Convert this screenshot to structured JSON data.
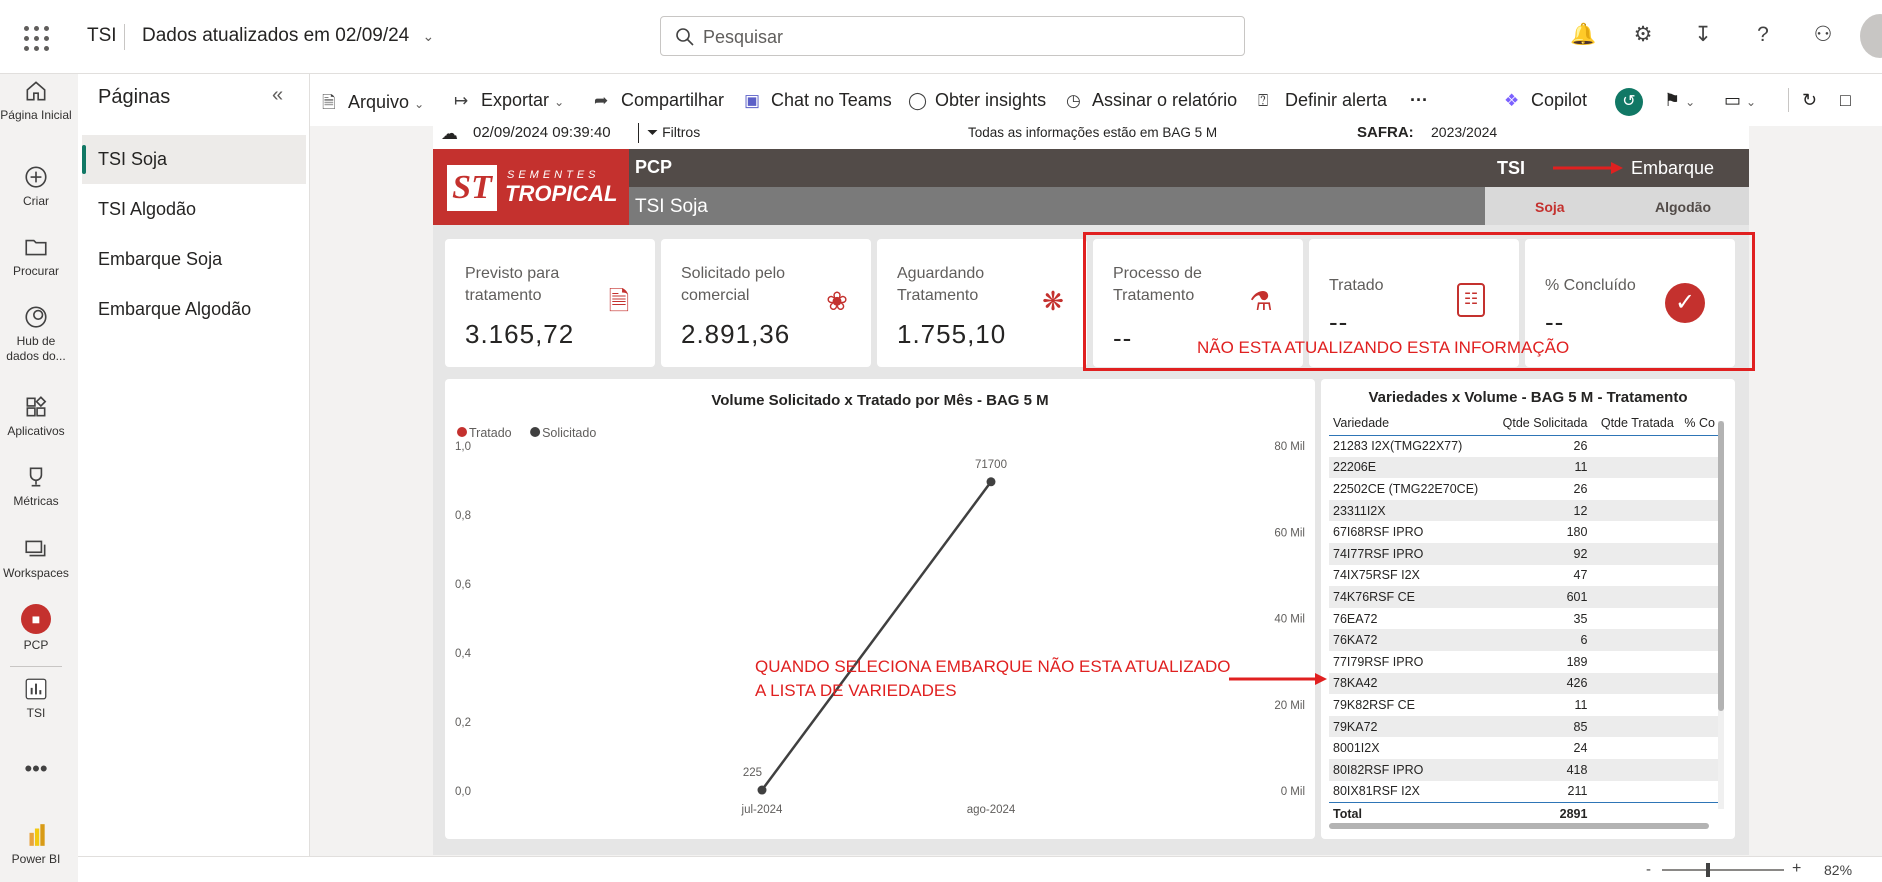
{
  "topbar": {
    "app_name": "TSI",
    "data_updated": "Dados atualizados em 02/09/24",
    "search_placeholder": "Pesquisar"
  },
  "leftnav": [
    {
      "label": "Página Inicial",
      "icon": "home-icon"
    },
    {
      "label": "Criar",
      "icon": "plus-circle-icon"
    },
    {
      "label": "Procurar",
      "icon": "folder-icon"
    },
    {
      "label": "Hub de dados do...",
      "icon": "data-hub-icon"
    },
    {
      "label": "Aplicativos",
      "icon": "apps-icon"
    },
    {
      "label": "Métricas",
      "icon": "trophy-icon"
    },
    {
      "label": "Workspaces",
      "icon": "workspaces-icon"
    },
    {
      "label": "PCP",
      "icon": "pcp-workspace-icon"
    },
    {
      "label": "TSI",
      "icon": "report-icon"
    },
    {
      "label": "Power BI",
      "icon": "powerbi-logo-icon"
    }
  ],
  "pages": {
    "title": "Páginas",
    "items": [
      "TSI Soja",
      "TSI Algodão",
      "Embarque Soja",
      "Embarque Algodão"
    ]
  },
  "commands": [
    "Arquivo",
    "Exportar",
    "Compartilhar",
    "Chat no Teams",
    "Obter insights",
    "Assinar o relatório",
    "Definir alerta",
    "Copilot"
  ],
  "report": {
    "timestamp": "02/09/2024 09:39:40",
    "filters_label": "Filtros",
    "info_note": "Todas as informações estão em BAG 5 M",
    "safra_label": "SAFRA:",
    "safra_value": "2023/2024",
    "section": "PCP",
    "page_subtitle": "TSI Soja",
    "tsi_label": "TSI",
    "embarque_label": "Embarque",
    "tab_soja": "Soja",
    "tab_algodao": "Algodão",
    "logo_text_top": "SEMENTES",
    "logo_text_bottom": "TROPICAL",
    "logo_mark": "ST"
  },
  "kpis": [
    {
      "label": "Previsto para tratamento",
      "value": "3.165,72",
      "icon": "document-icon"
    },
    {
      "label": "Solicitado pelo comercial",
      "value": "2.891,36",
      "icon": "badge-check-icon"
    },
    {
      "label": "Aguardando Tratamento",
      "value": "1.755,10",
      "icon": "seeds-icon"
    },
    {
      "label": "Processo de Tratamento",
      "value": "--",
      "icon": "flask-icon"
    },
    {
      "label": "Tratado",
      "value": "--",
      "icon": "bag-icon"
    },
    {
      "label": "% Concluído",
      "value": "--",
      "icon": "checkmark-circle-icon"
    }
  ],
  "annotations": {
    "kpi_note": "NÃO ESTA ATUALIZANDO ESTA INFORMAÇÃO",
    "table_note_line1": "QUANDO SELECIONA EMBARQUE NÃO ESTA ATUALIZADO",
    "table_note_line2": "A LISTA DE VARIEDADES"
  },
  "chart_data": {
    "type": "line",
    "title": "Volume Solicitado x Tratado por Mês - BAG 5 M",
    "categories": [
      "jul-2024",
      "ago-2024"
    ],
    "series": [
      {
        "name": "Tratado",
        "values": [
          null,
          null
        ],
        "color": "#c4312e",
        "axis": "left"
      },
      {
        "name": "Solicitado",
        "values": [
          225,
          71700
        ],
        "color": "#404040",
        "axis": "right"
      }
    ],
    "data_labels": [
      "225",
      "71700"
    ],
    "y_left": {
      "ticks": [
        "0,0",
        "0,2",
        "0,4",
        "0,6",
        "0,8",
        "1,0"
      ],
      "range": [
        0,
        1
      ]
    },
    "y_right": {
      "ticks": [
        "0 Mil",
        "20 Mil",
        "40 Mil",
        "60 Mil",
        "80 Mil"
      ],
      "range": [
        0,
        80000
      ]
    },
    "legend": "top-left"
  },
  "table": {
    "title": "Variedades x Volume - BAG 5 M - Tratamento",
    "columns": [
      "Variedade",
      "Qtde Solicitada",
      "Qtde Tratada",
      "% Co"
    ],
    "rows": [
      [
        "21283 I2X(TMG22X77)",
        "26"
      ],
      [
        "22206E",
        "11"
      ],
      [
        "22502CE (TMG22E70CE)",
        "26"
      ],
      [
        "23311I2X",
        "12"
      ],
      [
        "67I68RSF IPRO",
        "180"
      ],
      [
        "74I77RSF IPRO",
        "92"
      ],
      [
        "74IX75RSF I2X",
        "47"
      ],
      [
        "74K76RSF CE",
        "601"
      ],
      [
        "76EA72",
        "35"
      ],
      [
        "76KA72",
        "6"
      ],
      [
        "77I79RSF IPRO",
        "189"
      ],
      [
        "78KA42",
        "426"
      ],
      [
        "79K82RSF CE",
        "11"
      ],
      [
        "79KA72",
        "85"
      ],
      [
        "8001I2X",
        "24"
      ],
      [
        "80I82RSF IPRO",
        "418"
      ],
      [
        "80IX81RSF I2X",
        "211"
      ]
    ],
    "total_label": "Total",
    "total_value": "2891"
  },
  "status": {
    "zoom": "82%"
  }
}
